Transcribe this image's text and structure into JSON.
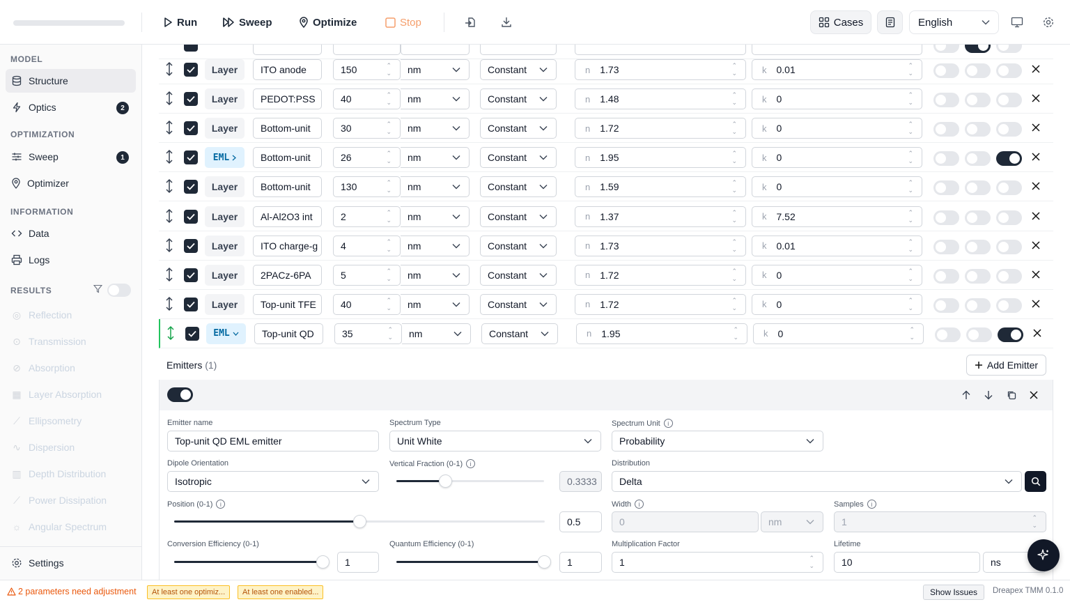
{
  "toolbar": {
    "run": "Run",
    "sweep": "Sweep",
    "optimize": "Optimize",
    "stop": "Stop",
    "cases": "Cases",
    "language": "English"
  },
  "sidebar": {
    "model_section": "MODEL",
    "structure": "Structure",
    "optics": "Optics",
    "optics_badge": "2",
    "optimization_section": "OPTIMIZATION",
    "sweep": "Sweep",
    "sweep_badge": "1",
    "optimizer": "Optimizer",
    "information_section": "INFORMATION",
    "data": "Data",
    "logs": "Logs",
    "results_section": "RESULTS",
    "results": [
      "Reflection",
      "Transmission",
      "Absorption",
      "Layer Absorption",
      "Ellipsometry",
      "Dispersion",
      "Depth Distribution",
      "Power Dissipation",
      "Angular Spectrum"
    ],
    "settings": "Settings"
  },
  "layers": [
    {
      "tag": "Layer",
      "name": "ITO anode",
      "thickness": "150",
      "unit": "nm",
      "model": "Constant",
      "n": "1.73",
      "k": "0.01",
      "emit": false
    },
    {
      "tag": "Layer",
      "name": "PEDOT:PSS",
      "thickness": "40",
      "unit": "nm",
      "model": "Constant",
      "n": "1.48",
      "k": "0",
      "emit": false
    },
    {
      "tag": "Layer",
      "name": "Bottom-unit",
      "thickness": "30",
      "unit": "nm",
      "model": "Constant",
      "n": "1.72",
      "k": "0",
      "emit": false
    },
    {
      "tag": "EML",
      "name": "Bottom-unit",
      "thickness": "26",
      "unit": "nm",
      "model": "Constant",
      "n": "1.95",
      "k": "0",
      "emit": true
    },
    {
      "tag": "Layer",
      "name": "Bottom-unit",
      "thickness": "130",
      "unit": "nm",
      "model": "Constant",
      "n": "1.59",
      "k": "0",
      "emit": false
    },
    {
      "tag": "Layer",
      "name": "Al-Al2O3 int",
      "thickness": "2",
      "unit": "nm",
      "model": "Constant",
      "n": "1.37",
      "k": "7.52",
      "emit": false
    },
    {
      "tag": "Layer",
      "name": "ITO charge-g",
      "thickness": "4",
      "unit": "nm",
      "model": "Constant",
      "n": "1.73",
      "k": "0.01",
      "emit": false
    },
    {
      "tag": "Layer",
      "name": "2PACz-6PA",
      "thickness": "5",
      "unit": "nm",
      "model": "Constant",
      "n": "1.72",
      "k": "0",
      "emit": false
    },
    {
      "tag": "Layer",
      "name": "Top-unit TFE",
      "thickness": "40",
      "unit": "nm",
      "model": "Constant",
      "n": "1.72",
      "k": "0",
      "emit": false
    },
    {
      "tag": "EML",
      "name": "Top-unit QD",
      "thickness": "35",
      "unit": "nm",
      "model": "Constant",
      "n": "1.95",
      "k": "0",
      "emit": true
    }
  ],
  "emitters": {
    "title": "Emitters",
    "count": "(1)",
    "add": "Add Emitter",
    "name_label": "Emitter name",
    "name": "Top-unit QD EML emitter",
    "spectrum_type_label": "Spectrum Type",
    "spectrum_type": "Unit White",
    "spectrum_unit_label": "Spectrum Unit",
    "spectrum_unit": "Probability",
    "dipole_label": "Dipole Orientation",
    "dipole": "Isotropic",
    "vertical_label": "Vertical Fraction (0-1)",
    "vertical": "0.3333",
    "distribution_label": "Distribution",
    "distribution": "Delta",
    "position_label": "Position (0-1)",
    "position": "0.5",
    "width_label": "Width",
    "width": "0",
    "width_unit": "nm",
    "samples_label": "Samples",
    "samples": "1",
    "conversion_label": "Conversion Efficiency (0-1)",
    "conversion": "1",
    "quantum_label": "Quantum Efficiency (0-1)",
    "quantum": "1",
    "multiplication_label": "Multiplication Factor",
    "multiplication": "1",
    "lifetime_label": "Lifetime",
    "lifetime": "10",
    "lifetime_unit": "ns"
  },
  "status": {
    "warning": "2 parameters need adjustment",
    "chip1": "At least one optimiz...",
    "chip2": "At least one enabled...",
    "show_issues": "Show Issues",
    "version": "Dreapex TMM 0.1.0"
  }
}
